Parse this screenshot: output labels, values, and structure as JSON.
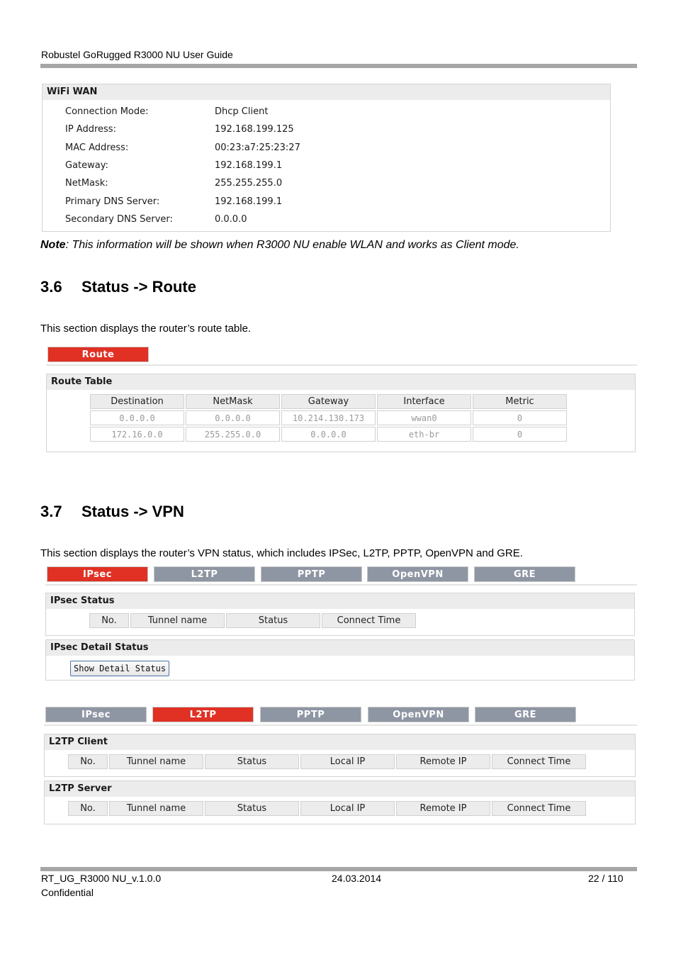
{
  "header": {
    "title": "Robustel GoRugged R3000 NU User Guide"
  },
  "wifi_wan": {
    "title": "WiFi WAN",
    "rows": [
      {
        "label": "Connection Mode:",
        "value": "Dhcp Client"
      },
      {
        "label": "IP Address:",
        "value": "192.168.199.125"
      },
      {
        "label": "MAC Address:",
        "value": "00:23:a7:25:23:27"
      },
      {
        "label": "Gateway:",
        "value": "192.168.199.1"
      },
      {
        "label": "NetMask:",
        "value": "255.255.255.0"
      },
      {
        "label": "Primary DNS Server:",
        "value": "192.168.199.1"
      },
      {
        "label": "Secondary DNS Server:",
        "value": "0.0.0.0"
      }
    ]
  },
  "note": {
    "bold": "Note",
    "text": ": This information will be shown when R3000 NU enable WLAN and works as Client mode."
  },
  "section_route": {
    "number": "3.6",
    "title": "Status -> Route",
    "description": "This section displays the router’s route table.",
    "tab": "Route",
    "panel_title": "Route Table",
    "columns": [
      "Destination",
      "NetMask",
      "Gateway",
      "Interface",
      "Metric"
    ],
    "rows": [
      [
        "0.0.0.0",
        "0.0.0.0",
        "10.214.130.173",
        "wwan0",
        "0"
      ],
      [
        "172.16.0.0",
        "255.255.0.0",
        "0.0.0.0",
        "eth-br",
        "0"
      ]
    ]
  },
  "section_vpn": {
    "number": "3.7",
    "title": "Status -> VPN",
    "description": "This section displays the router’s VPN status, which includes IPSec, L2TP, PPTP, OpenVPN and GRE.",
    "tabs": [
      "IPsec",
      "L2TP",
      "PPTP",
      "OpenVPN",
      "GRE"
    ],
    "ipsec": {
      "status_title": "IPsec Status",
      "status_columns": [
        "No.",
        "Tunnel name",
        "Status",
        "Connect Time"
      ],
      "detail_title": "IPsec Detail Status",
      "detail_button": "Show Detail Status"
    },
    "l2tp": {
      "client_title": "L2TP Client",
      "server_title": "L2TP Server",
      "columns": [
        "No.",
        "Tunnel name",
        "Status",
        "Local IP",
        "Remote IP",
        "Connect Time"
      ]
    }
  },
  "footer": {
    "doc_id": "RT_UG_R3000 NU_v.1.0.0",
    "date": "24.03.2014",
    "page": "22 / 110",
    "classification": "Confidential"
  },
  "colors": {
    "active_tab": "#e03124",
    "inactive_tab": "#8f96a3",
    "panel_header": "#ececec"
  }
}
